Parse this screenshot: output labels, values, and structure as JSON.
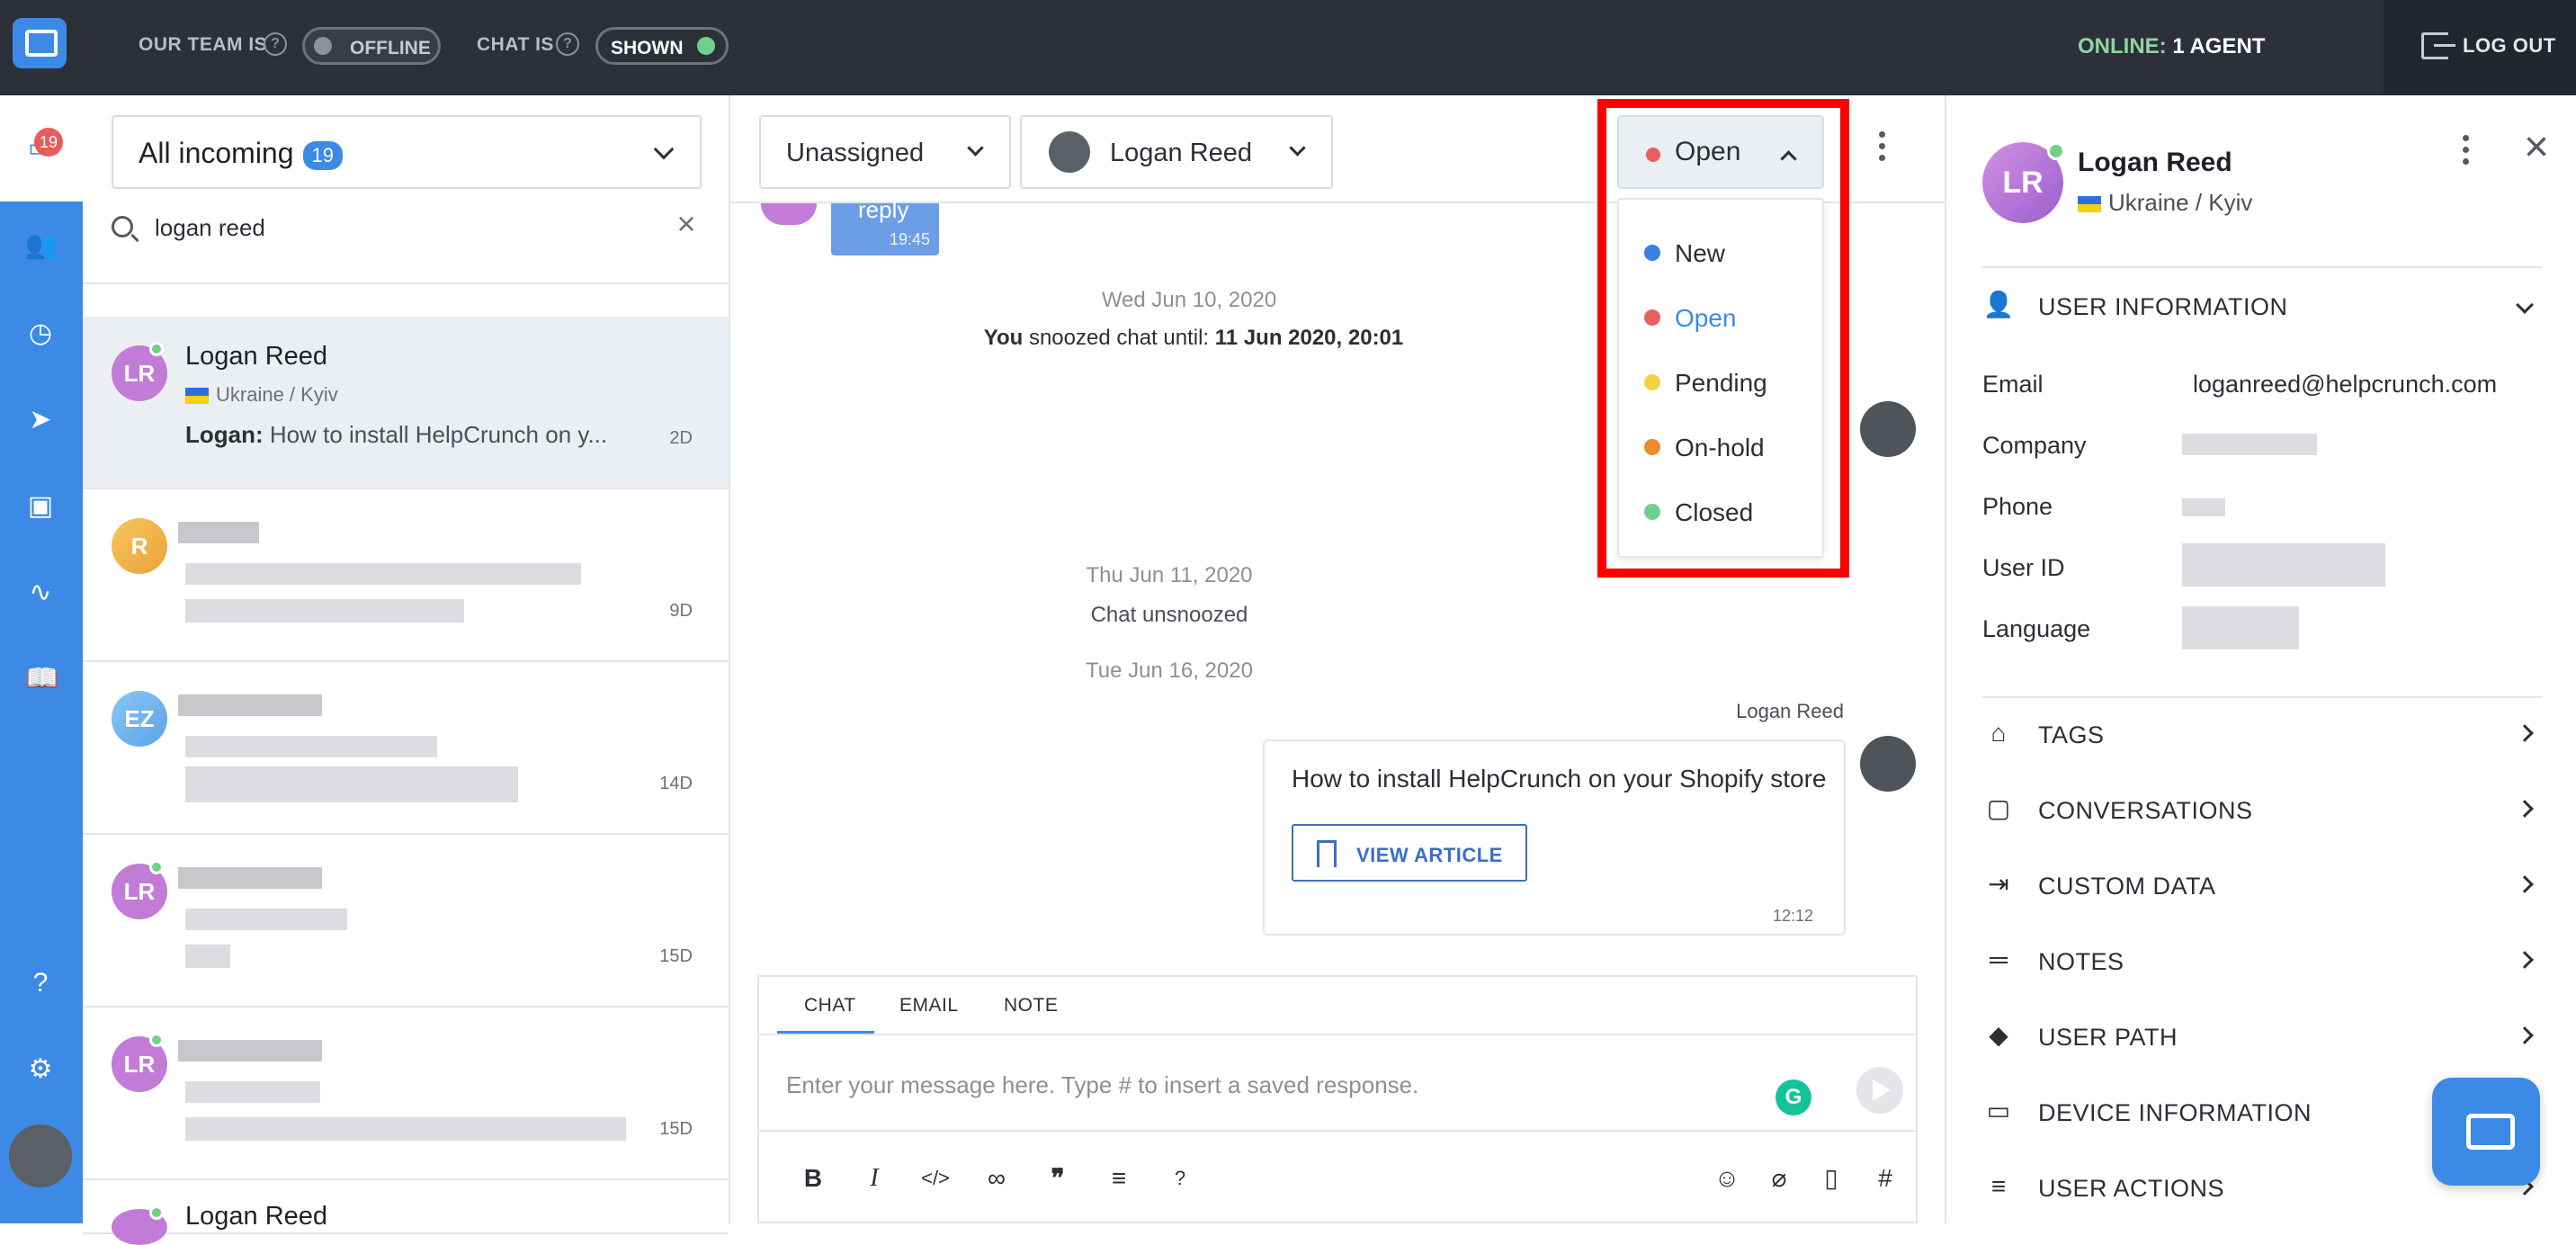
{
  "topbar": {
    "team_label": "OUR TEAM IS",
    "team_status": "OFFLINE",
    "chat_label": "CHAT IS",
    "chat_status": "SHOWN",
    "online_label": "ONLINE:",
    "online_value": "1 AGENT",
    "logout_label": "LOG OUT"
  },
  "sidebar": {
    "inbox_badge": "19",
    "items": [
      "inbox-icon",
      "contacts-icon",
      "history-icon",
      "send-icon",
      "ticket-icon",
      "activity-icon",
      "knowledge-base-icon",
      "help-icon",
      "settings-icon"
    ]
  },
  "list": {
    "inbox_select": "All incoming",
    "inbox_count": "19",
    "search_value": "logan reed",
    "conversations": [
      {
        "initials": "LR",
        "name": "Logan Reed",
        "location": "Ukraine / Kyiv",
        "sender": "Logan:",
        "message": "How to install HelpCrunch on y...",
        "when": "2D",
        "color": "#c27bd6"
      },
      {
        "initials": "R",
        "name": "",
        "location": "",
        "sender": "",
        "message": "",
        "when": "9D",
        "color": "#f2b84a"
      },
      {
        "initials": "EZ",
        "name": "",
        "location": "",
        "sender": "",
        "message": "",
        "when": "14D",
        "color": "#6fb5ee"
      },
      {
        "initials": "LR",
        "name": "",
        "location": "",
        "sender": "",
        "message": "",
        "when": "15D",
        "color": "#c27bd6"
      },
      {
        "initials": "LR",
        "name": "",
        "location": "",
        "sender": "",
        "message": "",
        "when": "15D",
        "color": "#c27bd6"
      },
      {
        "initials": "",
        "name": "Logan Reed",
        "location": "",
        "sender": "",
        "message": "",
        "when": "",
        "color": "#c27bd6"
      }
    ]
  },
  "chat": {
    "assignee_select": "Unassigned",
    "agent_select": "Logan Reed",
    "status": "Open",
    "status_options": [
      {
        "label": "New",
        "color": "#3a7fe0"
      },
      {
        "label": "Open",
        "color": "#e8605c"
      },
      {
        "label": "Pending",
        "color": "#f2d348"
      },
      {
        "label": "On-hold",
        "color": "#ef8a2e"
      },
      {
        "label": "Closed",
        "color": "#6fd08c"
      }
    ],
    "highlight_color": "#ff0000",
    "bubble_text": "reply",
    "bubble_time": "19:45",
    "date1": "Wed Jun 10, 2020",
    "snooze_you": "You",
    "snooze_text": "snoozed chat until:",
    "snooze_until": "11 Jun 2020, 20:01",
    "date2": "Thu Jun 11, 2020",
    "unsnoozed": "Chat unsnoozed",
    "date3": "Tue Jun 16, 2020",
    "msg_author": "Logan Reed",
    "msg_text": "How to install HelpCrunch on your Shopify store",
    "view_article": "VIEW ARTICLE",
    "msg_time": "12:12",
    "composer": {
      "tabs": [
        "CHAT",
        "EMAIL",
        "NOTE"
      ],
      "placeholder": "Enter your message here. Type # to insert a saved response."
    },
    "format_buttons": [
      "B",
      "I",
      "</>",
      "link",
      "quote",
      "align",
      "?",
      "emoji",
      "attach",
      "book",
      "#"
    ]
  },
  "profile": {
    "initials": "LR",
    "name": "Logan Reed",
    "location": "Ukraine / Kyiv",
    "user_info_title": "USER INFORMATION",
    "fields": [
      {
        "label": "Email",
        "value": "loganreed@helpcrunch.com"
      },
      {
        "label": "Company",
        "value": ""
      },
      {
        "label": "Phone",
        "value": ""
      },
      {
        "label": "User ID",
        "value": ""
      },
      {
        "label": "Language",
        "value": ""
      }
    ],
    "sections": [
      "TAGS",
      "CONVERSATIONS",
      "CUSTOM DATA",
      "NOTES",
      "USER PATH",
      "DEVICE INFORMATION",
      "USER ACTIONS"
    ]
  }
}
